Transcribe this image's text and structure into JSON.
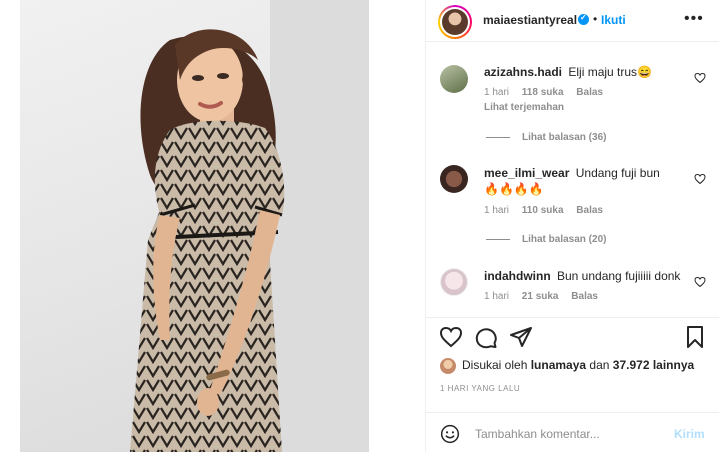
{
  "post": {
    "photo_alt": "Perempuan berambut panjang mengenakan gaun bermotif"
  },
  "header": {
    "username": "maiaestiantyreal",
    "separator": "•",
    "follow_label": "Ikuti",
    "more_label": "•••",
    "verified": true
  },
  "comments": [
    {
      "username": "azizahns.hadi",
      "text": "Elji maju trus😄",
      "time": "1 hari",
      "likes": "118 suka",
      "reply_label": "Balas",
      "translate_label": "Lihat terjemahan",
      "view_replies": "Lihat balasan (36)"
    },
    {
      "username": "mee_ilmi_wear",
      "text": "Undang fuji bun🔥🔥🔥🔥",
      "time": "1 hari",
      "likes": "110 suka",
      "reply_label": "Balas",
      "view_replies": "Lihat balasan (20)"
    },
    {
      "username": "indahdwinn",
      "text": "Bun undang fujiiiii donk",
      "time": "1 hari",
      "likes": "21 suka",
      "reply_label": "Balas"
    }
  ],
  "likes": {
    "prefix": "Disukai oleh",
    "user": "lunamaya",
    "joiner": "dan",
    "others": "37.972 lainnya"
  },
  "time_ago": "1 HARI YANG LALU",
  "composer": {
    "placeholder": "Tambahkan komentar...",
    "post_label": "Kirim"
  },
  "colors": {
    "accent": "#0095f6",
    "post_disabled": "#b2dffc",
    "muted": "#8e8e8e",
    "text": "#262626"
  }
}
